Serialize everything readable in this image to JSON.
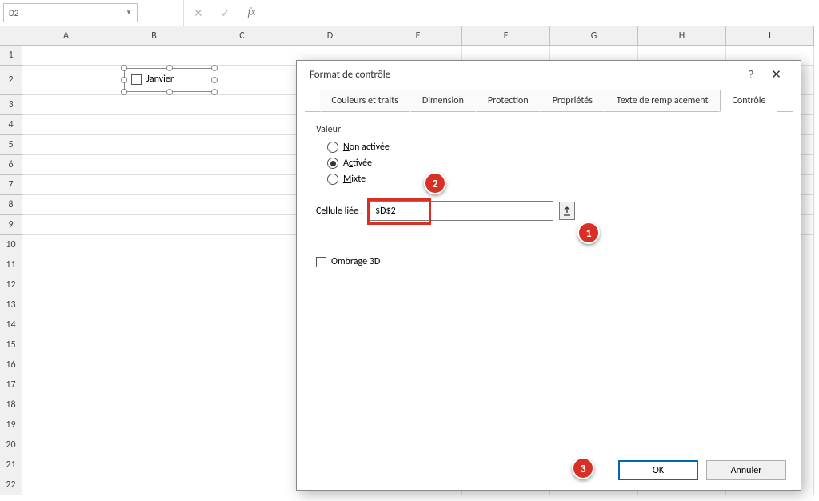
{
  "namebox": {
    "value": "D2"
  },
  "columns": [
    "A",
    "B",
    "C",
    "D",
    "E",
    "F",
    "G",
    "H",
    "I"
  ],
  "rows": [
    "1",
    "2",
    "3",
    "4",
    "5",
    "6",
    "7",
    "8",
    "9",
    "10",
    "11",
    "12",
    "13",
    "14",
    "15",
    "16",
    "17",
    "18",
    "19",
    "20",
    "21",
    "22"
  ],
  "checkbox_control": {
    "label": "Janvier"
  },
  "dialog": {
    "title": "Format de contrôle",
    "help": "?",
    "close": "✕",
    "tabs": {
      "t1": "Couleurs et traits",
      "t2": "Dimension",
      "t3": "Protection",
      "t4": "Propriétés",
      "t5": "Texte de remplacement",
      "t6": "Contrôle"
    },
    "group_valeur": "Valeur",
    "radio_non_prefix": "N",
    "radio_non_suffix": "on activée",
    "radio_act_prefix": "A",
    "radio_act_mid": "c",
    "radio_act_suffix": "tivée",
    "radio_mix_prefix": "M",
    "radio_mix_suffix": "ixte",
    "linked_label_prefix": "Cellule ",
    "linked_label_u": "l",
    "linked_label_suffix": "iée :",
    "linked_value": "$D$2",
    "shade_prefix": "Ombrage ",
    "shade_u": "3",
    "shade_suffix": "D",
    "ok": "OK",
    "cancel": "Annuler"
  },
  "callouts": {
    "c1": "1",
    "c2": "2",
    "c3": "3"
  }
}
